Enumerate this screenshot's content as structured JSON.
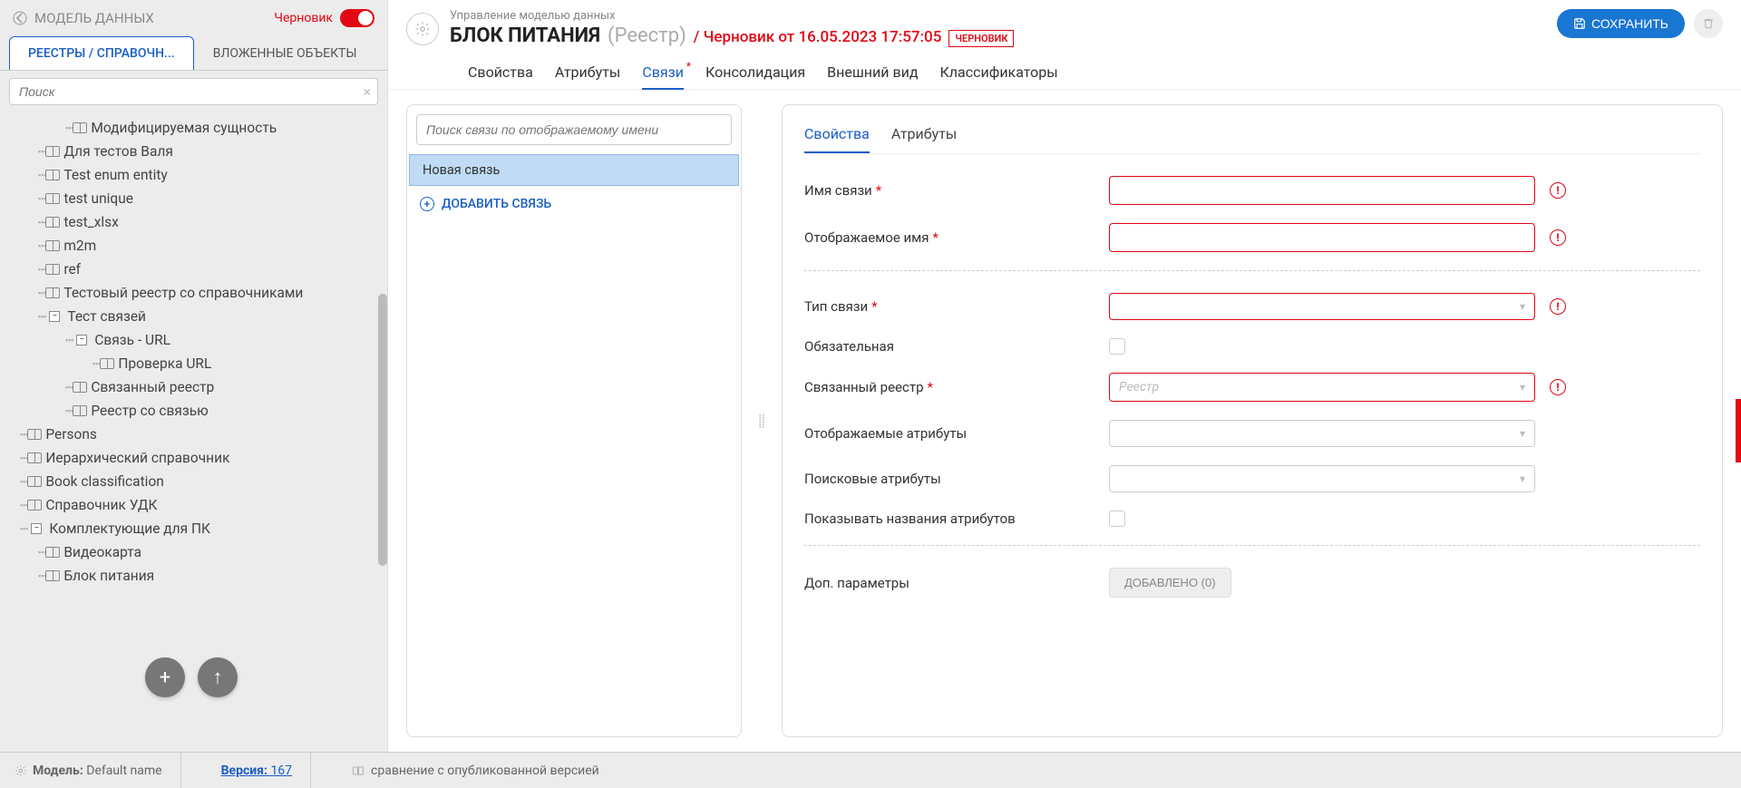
{
  "sidebar": {
    "title": "МОДЕЛЬ ДАННЫХ",
    "draft_label": "Черновик",
    "tabs": [
      "РЕЕСТРЫ / СПРАВОЧН...",
      "ВЛОЖЕННЫЕ ОБЪЕКТЫ"
    ],
    "search_placeholder": "Поиск",
    "tree": [
      {
        "indent": 60,
        "icon": "book",
        "label": "Модифицируемая сущность"
      },
      {
        "indent": 30,
        "icon": "book",
        "label": "Для тестов Валя"
      },
      {
        "indent": 30,
        "icon": "book",
        "label": "Test enum entity"
      },
      {
        "indent": 30,
        "icon": "book",
        "label": "test unique"
      },
      {
        "indent": 30,
        "icon": "book",
        "label": "test_xlsx"
      },
      {
        "indent": 30,
        "icon": "book",
        "label": "m2m"
      },
      {
        "indent": 30,
        "icon": "book",
        "label": "ref"
      },
      {
        "indent": 30,
        "icon": "book",
        "label": "Тестовый реестр со справочниками"
      },
      {
        "indent": 30,
        "toggle": "−",
        "label": "Тест связей"
      },
      {
        "indent": 60,
        "toggle": "−",
        "label": "Связь - URL"
      },
      {
        "indent": 90,
        "icon": "book",
        "label": "Проверка URL"
      },
      {
        "indent": 60,
        "icon": "book",
        "label": "Связанный реестр"
      },
      {
        "indent": 60,
        "icon": "book",
        "label": "Реестр со связью"
      },
      {
        "indent": 10,
        "icon": "book",
        "label": "Persons"
      },
      {
        "indent": 10,
        "icon": "book",
        "label": "Иерархический справочник"
      },
      {
        "indent": 10,
        "icon": "book",
        "label": "Book classification"
      },
      {
        "indent": 10,
        "icon": "book",
        "label": "Справочник УДК"
      },
      {
        "indent": 10,
        "toggle": "−",
        "label": "Комплектующие для ПК"
      },
      {
        "indent": 30,
        "icon": "book",
        "label": "Видеокарта"
      },
      {
        "indent": 30,
        "icon": "book",
        "label": "Блок питания"
      }
    ]
  },
  "header": {
    "breadcrumb": "Управление моделью данных",
    "title": "БЛОК ПИТАНИЯ",
    "subtitle": "(Реестр)",
    "draft_info": "/ Черновик от 16.05.2023 17:57:05",
    "badge": "ЧЕРНОВИК",
    "save": "СОХРАНИТЬ"
  },
  "content_tabs": [
    "Свойства",
    "Атрибуты",
    "Связи",
    "Консолидация",
    "Внешний вид",
    "Классификаторы"
  ],
  "content_tabs_active": 2,
  "content_tabs_modified": 2,
  "links": {
    "search_placeholder": "Поиск связи по отображаемому имени",
    "item": "Новая связь",
    "add": "ДОБАВИТЬ СВЯЗЬ"
  },
  "form": {
    "tabs": [
      "Свойства",
      "Атрибуты"
    ],
    "fields": {
      "name": {
        "label": "Имя связи",
        "required": true,
        "error": true
      },
      "display_name": {
        "label": "Отображаемое имя",
        "required": true,
        "error": true
      },
      "type": {
        "label": "Тип связи",
        "required": true,
        "error": true,
        "kind": "select"
      },
      "mandatory": {
        "label": "Обязательная",
        "kind": "checkbox"
      },
      "linked_registry": {
        "label": "Связанный реестр",
        "required": true,
        "error": true,
        "kind": "select",
        "placeholder": "Реестр"
      },
      "display_attrs": {
        "label": "Отображаемые атрибуты",
        "kind": "select",
        "normal": true
      },
      "search_attrs": {
        "label": "Поисковые атрибуты",
        "kind": "select",
        "normal": true
      },
      "show_attr_names": {
        "label": "Показывать названия атрибутов",
        "kind": "checkbox"
      },
      "extra": {
        "label": "Доп. параметры",
        "button": "ДОБАВЛЕНО (0)"
      }
    }
  },
  "footer": {
    "model_label": "Модель:",
    "model_value": "Default name",
    "version_label": "Версия:",
    "version_value": "167",
    "compare": "сравнение с опубликованной версией"
  }
}
